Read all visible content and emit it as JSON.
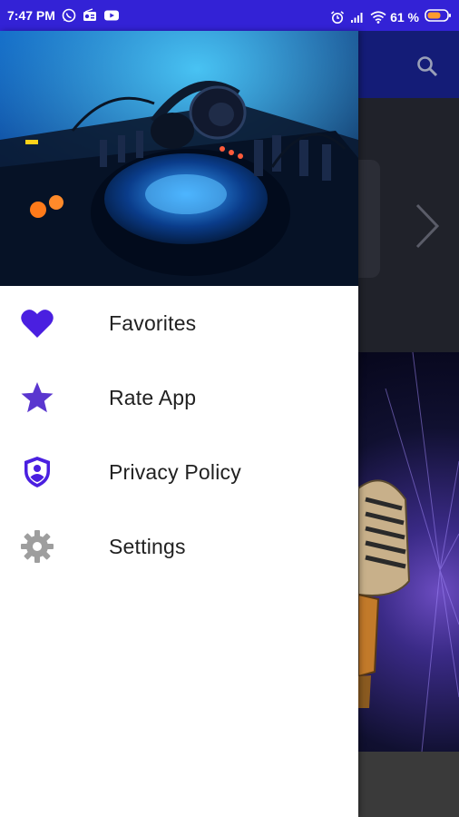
{
  "status_bar": {
    "time": "7:47 PM",
    "battery": "61 %",
    "left_icons": [
      "whatsapp-icon",
      "radio-icon",
      "youtube-icon"
    ],
    "right_icons": [
      "alarm-icon",
      "signal-icon",
      "wifi-icon",
      "battery-icon"
    ]
  },
  "colors": {
    "status_bar": "#3322d6",
    "accent": "#4a1fe0",
    "settings_icon": "#9e9e9e",
    "app_bar": "#141c77"
  },
  "background_app": {
    "icons": [
      "search-icon",
      "chevron-right-icon"
    ]
  },
  "drawer": {
    "header_image": "dj-turntable-headphones",
    "items": [
      {
        "label": "Favorites",
        "icon": "heart-icon"
      },
      {
        "label": "Rate App",
        "icon": "star-icon"
      },
      {
        "label": "Privacy Policy",
        "icon": "shield-person-icon"
      },
      {
        "label": "Settings",
        "icon": "gear-icon"
      }
    ]
  }
}
